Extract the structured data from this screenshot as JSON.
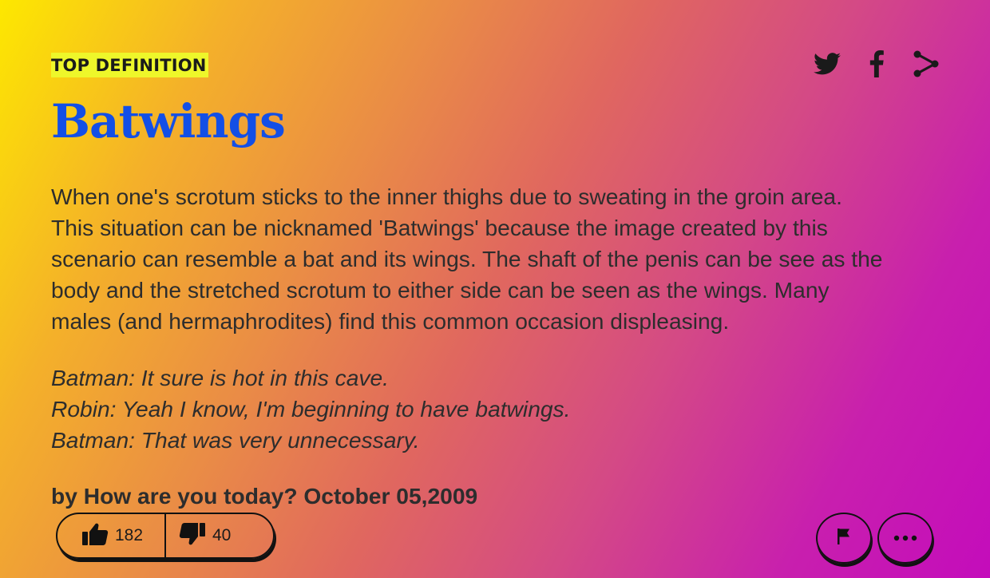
{
  "definition": {
    "badge": "TOP DEFINITION",
    "word": "Batwings",
    "meaning_lines": [
      "When one's scrotum sticks to the inner thighs due to sweating in the groin area.",
      "This situation can be nicknamed 'Batwings' because the image created by this",
      "scenario can resemble a bat and its wings. The shaft of the penis can be see as the",
      "body and the stretched scrotum to either side can be seen as the wings. Many",
      "males (and hermaphrodites) find this common occasion displeasing."
    ],
    "example_lines": [
      "Batman: It sure is hot in this cave.",
      "Robin: Yeah I know, I'm beginning to have batwings.",
      "Batman: That was very unnecessary."
    ],
    "contributor": "by How are you today? October 05,2009"
  },
  "votes": {
    "up": "182",
    "down": "40"
  },
  "icons": {
    "share": [
      "twitter-icon",
      "facebook-icon",
      "share-icon"
    ],
    "thumbs_up": "thumbs-up-icon",
    "thumbs_down": "thumbs-down-icon",
    "flag": "flag-icon",
    "more": "ellipsis-icon"
  },
  "colors": {
    "word": "#134fe6",
    "badge_bg": "#eef72a",
    "gradient_start": "#fde800",
    "gradient_end": "#c40cbb",
    "text": "#2d2d2d"
  }
}
